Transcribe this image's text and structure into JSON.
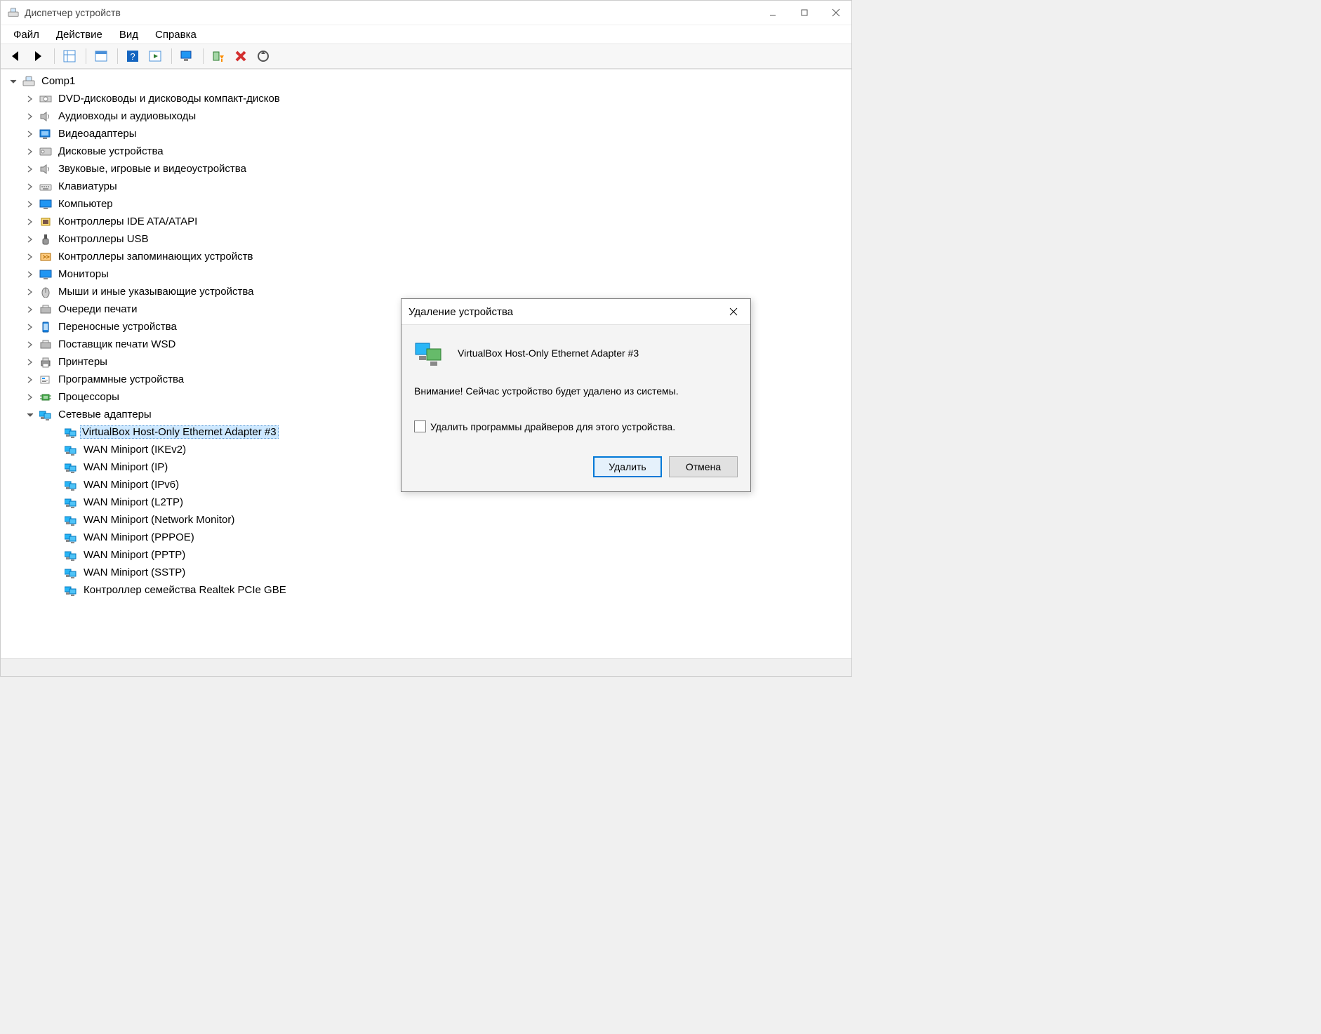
{
  "window": {
    "title": "Диспетчер устройств",
    "controls": {
      "minimize": "–",
      "maximize": "▢",
      "close": "✕"
    },
    "menu": [
      "Файл",
      "Действие",
      "Вид",
      "Справка"
    ],
    "toolbar": {
      "back": "back-icon",
      "forward": "forward-icon",
      "show_hidden": "show-hidden-icon",
      "properties": "properties-icon",
      "help": "help-icon",
      "refresh": "refresh-icon",
      "monitor": "monitor-icon",
      "enable_install": "install-icon",
      "delete": "delete-icon",
      "scan": "scan-icon"
    }
  },
  "tree": {
    "root": {
      "label": "Comp1",
      "icon": "computer-root-icon",
      "expanded": true
    },
    "categories": [
      {
        "label": "DVD-дисководы и дисководы компакт-дисков",
        "icon": "disc-drive-icon",
        "expanded": false
      },
      {
        "label": "Аудиовходы и аудиовыходы",
        "icon": "audio-io-icon",
        "expanded": false
      },
      {
        "label": "Видеоадаптеры",
        "icon": "display-adapter-icon",
        "expanded": false
      },
      {
        "label": "Дисковые устройства",
        "icon": "disk-icon",
        "expanded": false
      },
      {
        "label": "Звуковые, игровые и видеоустройства",
        "icon": "sound-icon",
        "expanded": false
      },
      {
        "label": "Клавиатуры",
        "icon": "keyboard-icon",
        "expanded": false
      },
      {
        "label": "Компьютер",
        "icon": "computer-icon",
        "expanded": false
      },
      {
        "label": "Контроллеры IDE ATA/ATAPI",
        "icon": "ide-icon",
        "expanded": false
      },
      {
        "label": "Контроллеры USB",
        "icon": "usb-icon",
        "expanded": false
      },
      {
        "label": "Контроллеры запоминающих устройств",
        "icon": "storage-ctrl-icon",
        "expanded": false
      },
      {
        "label": "Мониторы",
        "icon": "monitor-icon",
        "expanded": false
      },
      {
        "label": "Мыши и иные указывающие устройства",
        "icon": "mouse-icon",
        "expanded": false
      },
      {
        "label": "Очереди печати",
        "icon": "print-queue-icon",
        "expanded": false
      },
      {
        "label": "Переносные устройства",
        "icon": "portable-icon",
        "expanded": false
      },
      {
        "label": "Поставщик печати WSD",
        "icon": "print-provider-icon",
        "expanded": false
      },
      {
        "label": "Принтеры",
        "icon": "printer-icon",
        "expanded": false
      },
      {
        "label": "Программные устройства",
        "icon": "software-device-icon",
        "expanded": false
      },
      {
        "label": "Процессоры",
        "icon": "cpu-icon",
        "expanded": false
      },
      {
        "label": "Сетевые адаптеры",
        "icon": "network-icon",
        "expanded": true,
        "children": [
          {
            "label": "VirtualBox Host-Only Ethernet Adapter #3",
            "icon": "network-icon",
            "selected": true
          },
          {
            "label": "WAN Miniport (IKEv2)",
            "icon": "network-icon"
          },
          {
            "label": "WAN Miniport (IP)",
            "icon": "network-icon"
          },
          {
            "label": "WAN Miniport (IPv6)",
            "icon": "network-icon"
          },
          {
            "label": "WAN Miniport (L2TP)",
            "icon": "network-icon"
          },
          {
            "label": "WAN Miniport (Network Monitor)",
            "icon": "network-icon"
          },
          {
            "label": "WAN Miniport (PPPOE)",
            "icon": "network-icon"
          },
          {
            "label": "WAN Miniport (PPTP)",
            "icon": "network-icon"
          },
          {
            "label": "WAN Miniport (SSTP)",
            "icon": "network-icon"
          },
          {
            "label": "Контроллер семейства Realtek PCIe GBE",
            "icon": "network-icon"
          }
        ]
      }
    ]
  },
  "dialog": {
    "title": "Удаление устройства",
    "device_name": "VirtualBox Host-Only Ethernet Adapter #3",
    "warning": "Внимание! Сейчас устройство будет удалено из системы.",
    "checkbox_label": "Удалить программы драйверов для этого устройства.",
    "checkbox_checked": false,
    "primary_button": "Удалить",
    "secondary_button": "Отмена"
  }
}
